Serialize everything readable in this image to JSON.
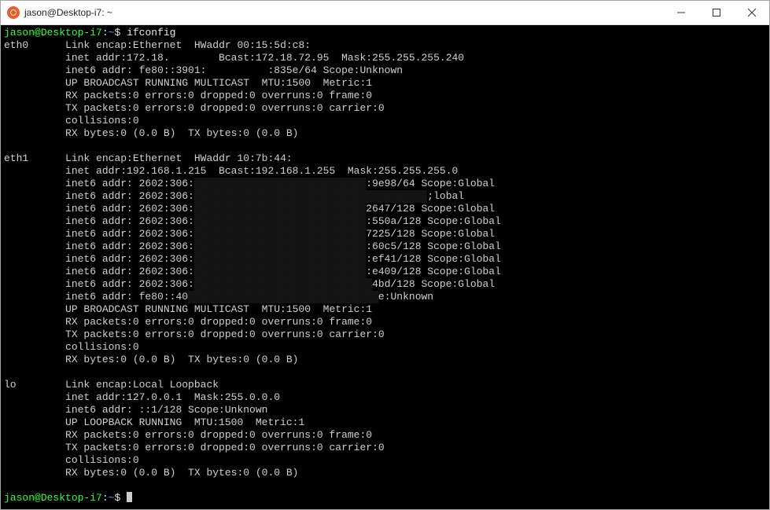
{
  "window": {
    "title": "jason@Desktop-i7: ~"
  },
  "prompt": {
    "user": "jason",
    "at": "@",
    "host": "Desktop-i7",
    "colon": ":",
    "path": "~",
    "sep": "$ ",
    "cmd": "ifconfig",
    "path2": "~",
    "sep2": "$ "
  },
  "eth0": {
    "name": "eth0",
    "l1a": "Link encap:Ethernet  HWaddr 00:15:5d:c8:",
    "l2": "inet addr:172.18.        Bcast:172.18.72.95  Mask:255.255.255.240",
    "l3": "inet6 addr: fe80::3901:          :835e/64 Scope:Unknown",
    "l4": "UP BROADCAST RUNNING MULTICAST  MTU:1500  Metric:1",
    "l5": "RX packets:0 errors:0 dropped:0 overruns:0 frame:0",
    "l6": "TX packets:0 errors:0 dropped:0 overruns:0 carrier:0",
    "l7": "collisions:0",
    "l8": "RX bytes:0 (0.0 B)  TX bytes:0 (0.0 B)"
  },
  "eth1": {
    "name": "eth1",
    "l1a": "Link encap:Ethernet  HWaddr 10:7b:44:",
    "l2": "inet addr:192.168.1.215  Bcast:192.168.1.255  Mask:255.255.255.0",
    "a1a": "inet6 addr: 2602:306:",
    "a1b": ":9e98/64 Scope:Global",
    "a2a": "inet6 addr: 2602:306:",
    "a2b": ";lobal",
    "a3a": "inet6 addr: 2602:306:",
    "a3b": "2647/128 Scope:Global",
    "a4a": "inet6 addr: 2602:306:",
    "a4b": ":550a/128 Scope:Global",
    "a5a": "inet6 addr: 2602:306:",
    "a5b": "7225/128 Scope:Global",
    "a6a": "inet6 addr: 2602:306:",
    "a6b": ":60c5/128 Scope:Global",
    "a7a": "inet6 addr: 2602:306:",
    "a7b": ":ef41/128 Scope:Global",
    "a8a": "inet6 addr: 2602:306:",
    "a8b": ":e409/128 Scope:Global",
    "a9a": "inet6 addr: 2602:306:",
    "a9b": "4bd/128 Scope:Global",
    "a10a": "inet6 addr: fe80::40",
    "a10b": "e:Unknown",
    "l4": "UP BROADCAST RUNNING MULTICAST  MTU:1500  Metric:1",
    "l5": "RX packets:0 errors:0 dropped:0 overruns:0 frame:0",
    "l6": "TX packets:0 errors:0 dropped:0 overruns:0 carrier:0",
    "l7": "collisions:0",
    "l8": "RX bytes:0 (0.0 B)  TX bytes:0 (0.0 B)"
  },
  "lo": {
    "name": "lo",
    "l1": "Link encap:Local Loopback",
    "l2": "inet addr:127.0.0.1  Mask:255.0.0.0",
    "l3": "inet6 addr: ::1/128 Scope:Unknown",
    "l4": "UP LOOPBACK RUNNING  MTU:1500  Metric:1",
    "l5": "RX packets:0 errors:0 dropped:0 overruns:0 frame:0",
    "l6": "TX packets:0 errors:0 dropped:0 overruns:0 carrier:0",
    "l7": "collisions:0",
    "l8": "RX bytes:0 (0.0 B)  TX bytes:0 (0.0 B)"
  }
}
